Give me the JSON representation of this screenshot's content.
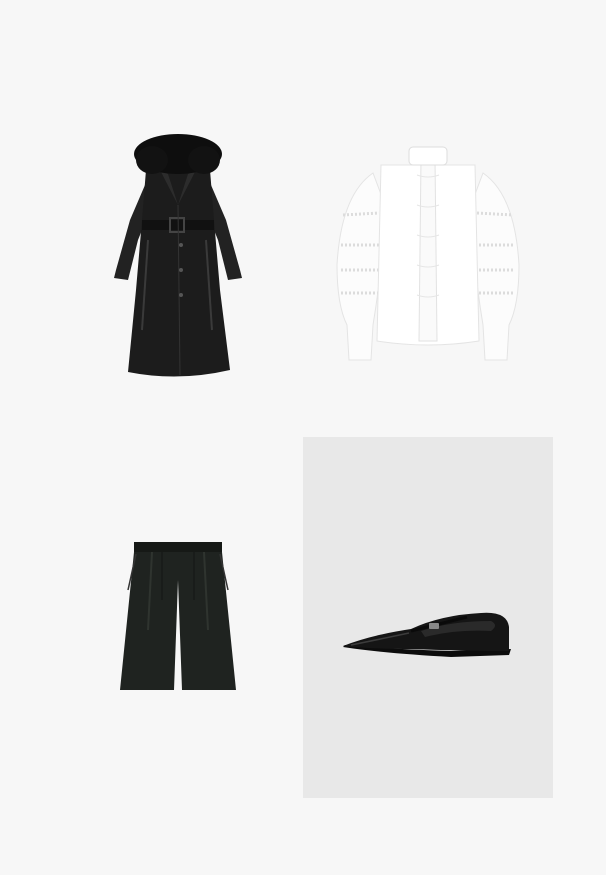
{
  "items": [
    {
      "key": "coat",
      "icon": "leather-coat-icon",
      "color": "#1c1c1c"
    },
    {
      "key": "blouse",
      "icon": "white-blouse-icon",
      "color": "#ffffff"
    },
    {
      "key": "shorts",
      "icon": "bermuda-shorts-icon",
      "color": "#1f2320"
    },
    {
      "key": "shoe",
      "icon": "mary-jane-flat-icon",
      "color": "#151515"
    }
  ],
  "colors": {
    "page_bg": "#f7f7f7",
    "shoe_panel_bg": "#e8e8e8"
  }
}
